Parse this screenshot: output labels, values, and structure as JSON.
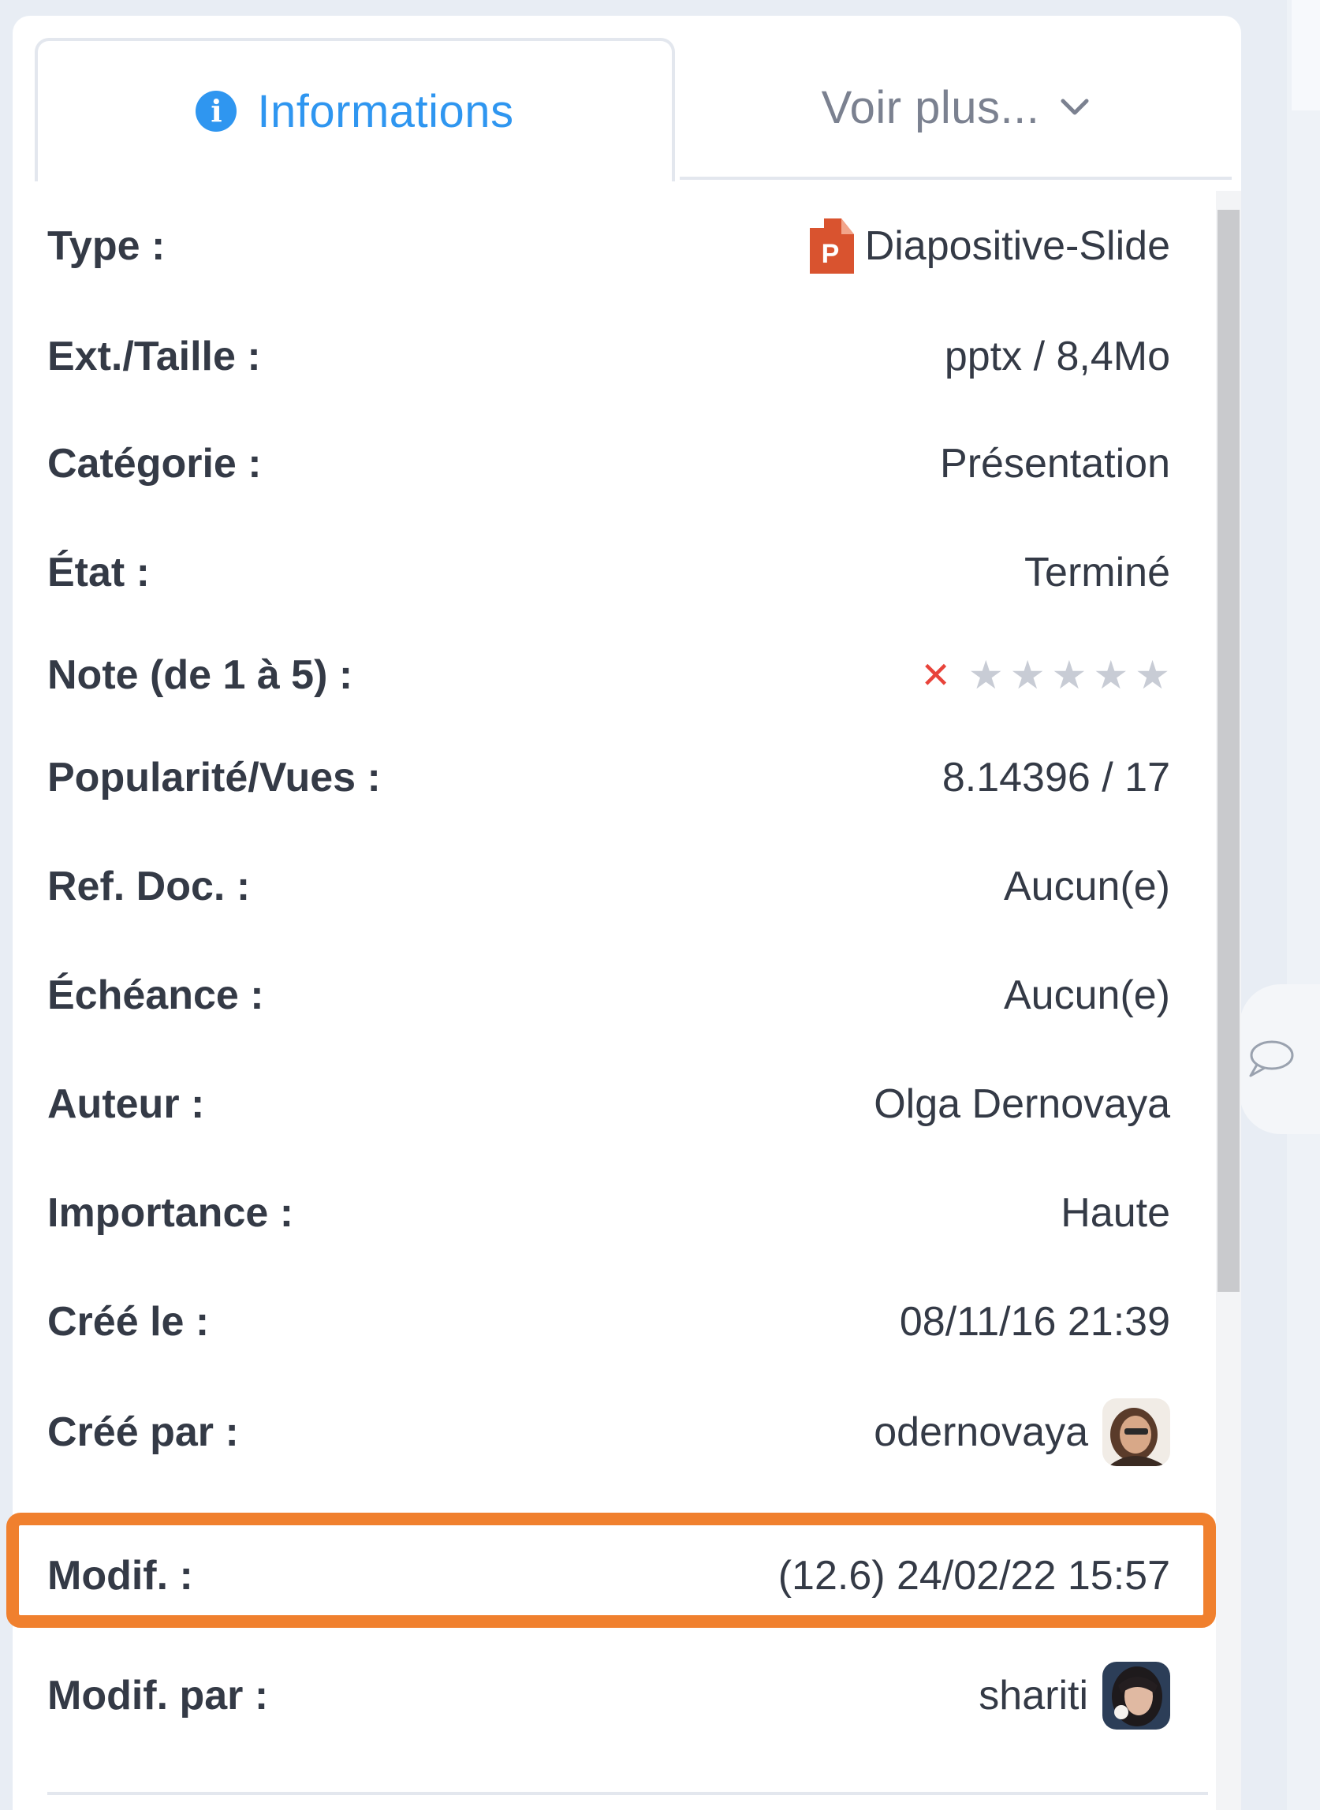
{
  "tabs": {
    "informations": "Informations",
    "voir_plus": "Voir plus..."
  },
  "rows": [
    {
      "label": "Type :",
      "value": "Diapositive-Slide",
      "icon": "powerpoint-file-icon"
    },
    {
      "label": "Ext./Taille :",
      "value": "pptx / 8,4Mo"
    },
    {
      "label": "Catégorie :",
      "value": "Présentation"
    },
    {
      "label": "État :",
      "value": "Terminé"
    },
    {
      "label": "Note (de 1 à 5) :",
      "rating": 0,
      "rating_max": 5,
      "clear_glyph": "✕",
      "star_glyph": "★"
    },
    {
      "label": "Popularité/Vues :",
      "value": "8.14396 / 17"
    },
    {
      "label": "Ref. Doc. :",
      "value": "Aucun(e)"
    },
    {
      "label": "Échéance :",
      "value": "Aucun(e)"
    },
    {
      "label": "Auteur :",
      "value": "Olga Dernovaya"
    },
    {
      "label": "Importance :",
      "value": "Haute"
    },
    {
      "label": "Créé le :",
      "value": "08/11/16 21:39"
    },
    {
      "label": "Créé par :",
      "value": "odernovaya",
      "avatar": "user-avatar"
    },
    {
      "label": "Modif. :",
      "value": "(12.6) 24/02/22 15:57",
      "highlighted": true
    },
    {
      "label": "Modif. par :",
      "value": "shariti",
      "avatar": "user-avatar"
    }
  ],
  "colors": {
    "accent": "#2f96f0",
    "highlight": "#f0802e",
    "clear": "#e8433a",
    "star_empty": "#c8ccd5",
    "text": "#343a46",
    "powerpoint": "#d9532f"
  },
  "icons": {
    "info": "info-circle-icon",
    "chevron": "chevron-down-icon",
    "comment": "comment-bubble-icon"
  }
}
